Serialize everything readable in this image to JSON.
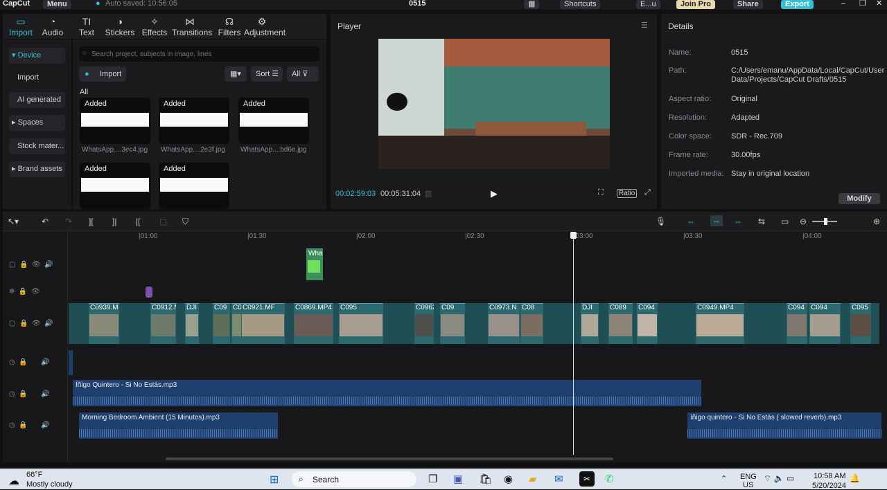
{
  "titlebar": {
    "app": "CapCut",
    "menu": "Menu",
    "autosave": "Auto saved: 10:56:05",
    "project": "0515",
    "shortcuts": "Shortcuts",
    "user": "E...u",
    "join": "Join Pro",
    "share": "Share",
    "export": "Export"
  },
  "tools": [
    "Import",
    "Audio",
    "Text",
    "Stickers",
    "Effects",
    "Transitions",
    "Filters",
    "Adjustment"
  ],
  "tool_icons": [
    "import-icon",
    "audio-icon",
    "text-icon",
    "stickers-icon",
    "effects-icon",
    "transitions-icon",
    "filters-icon",
    "adjustment-icon"
  ],
  "nav": {
    "device": "Device",
    "import": "Import",
    "ai": "AI generated",
    "spaces": "Spaces",
    "stock": "Stock mater...",
    "brand": "Brand assets"
  },
  "media": {
    "search_placeholder": "Search project, subjects in image, lines",
    "import": "Import",
    "sort": "Sort",
    "all_filter": "All",
    "all_label": "All",
    "cards": [
      {
        "label": "Added",
        "name": "WhatsApp....3ec4.jpg"
      },
      {
        "label": "Added",
        "name": "WhatsApp....2e3f.jpg"
      },
      {
        "label": "Added",
        "name": "WhatsApp....bd6e.jpg"
      },
      {
        "label": "Added",
        "name": ""
      },
      {
        "label": "Added",
        "name": ""
      }
    ]
  },
  "player": {
    "title": "Player",
    "current": "00:02:59:03",
    "total": "00:05:31:04",
    "ratio": "Ratio"
  },
  "details": {
    "title": "Details",
    "rows": [
      {
        "k": "Name:",
        "v": "0515"
      },
      {
        "k": "Path:",
        "v": "C:/Users/emanu/AppData/Local/CapCut/User Data/Projects/CapCut Drafts/0515"
      },
      {
        "k": "Aspect ratio:",
        "v": "Original"
      },
      {
        "k": "Resolution:",
        "v": "Adapted"
      },
      {
        "k": "Color space:",
        "v": "SDR - Rec.709"
      },
      {
        "k": "Frame rate:",
        "v": "30.00fps"
      },
      {
        "k": "Imported media:",
        "v": "Stay in original location"
      }
    ],
    "modify": "Modify"
  },
  "timeline": {
    "ticks": [
      "|01:00",
      "|01:30",
      "|02:00",
      "|02:30",
      "|03:00",
      "|03:30",
      "|04:00"
    ],
    "overlay_clip": "Wha",
    "clips": [
      "C0939.M",
      "C0912.M",
      "DJI",
      "C09",
      "C092",
      "C0921.MF",
      "C0869.MP4",
      "C095",
      "C0962",
      "C09",
      "C0973.N",
      "C08",
      "DJI",
      "C089",
      "C094",
      "C0949.MP4",
      "C094",
      "C094",
      "C095"
    ],
    "audio": [
      "Íñigo Quintero - Si No Estás.mp3",
      "Morning Bedroom Ambient (15 Minutes).mp3",
      "íñigo quintero - Si No Estás ( slowed  reverb).mp3"
    ]
  },
  "taskbar": {
    "temp": "66°F",
    "weather": "Mostly cloudy",
    "search": "Search",
    "lang1": "ENG",
    "lang2": "US",
    "time": "10:58 AM",
    "date": "5/20/2024"
  }
}
